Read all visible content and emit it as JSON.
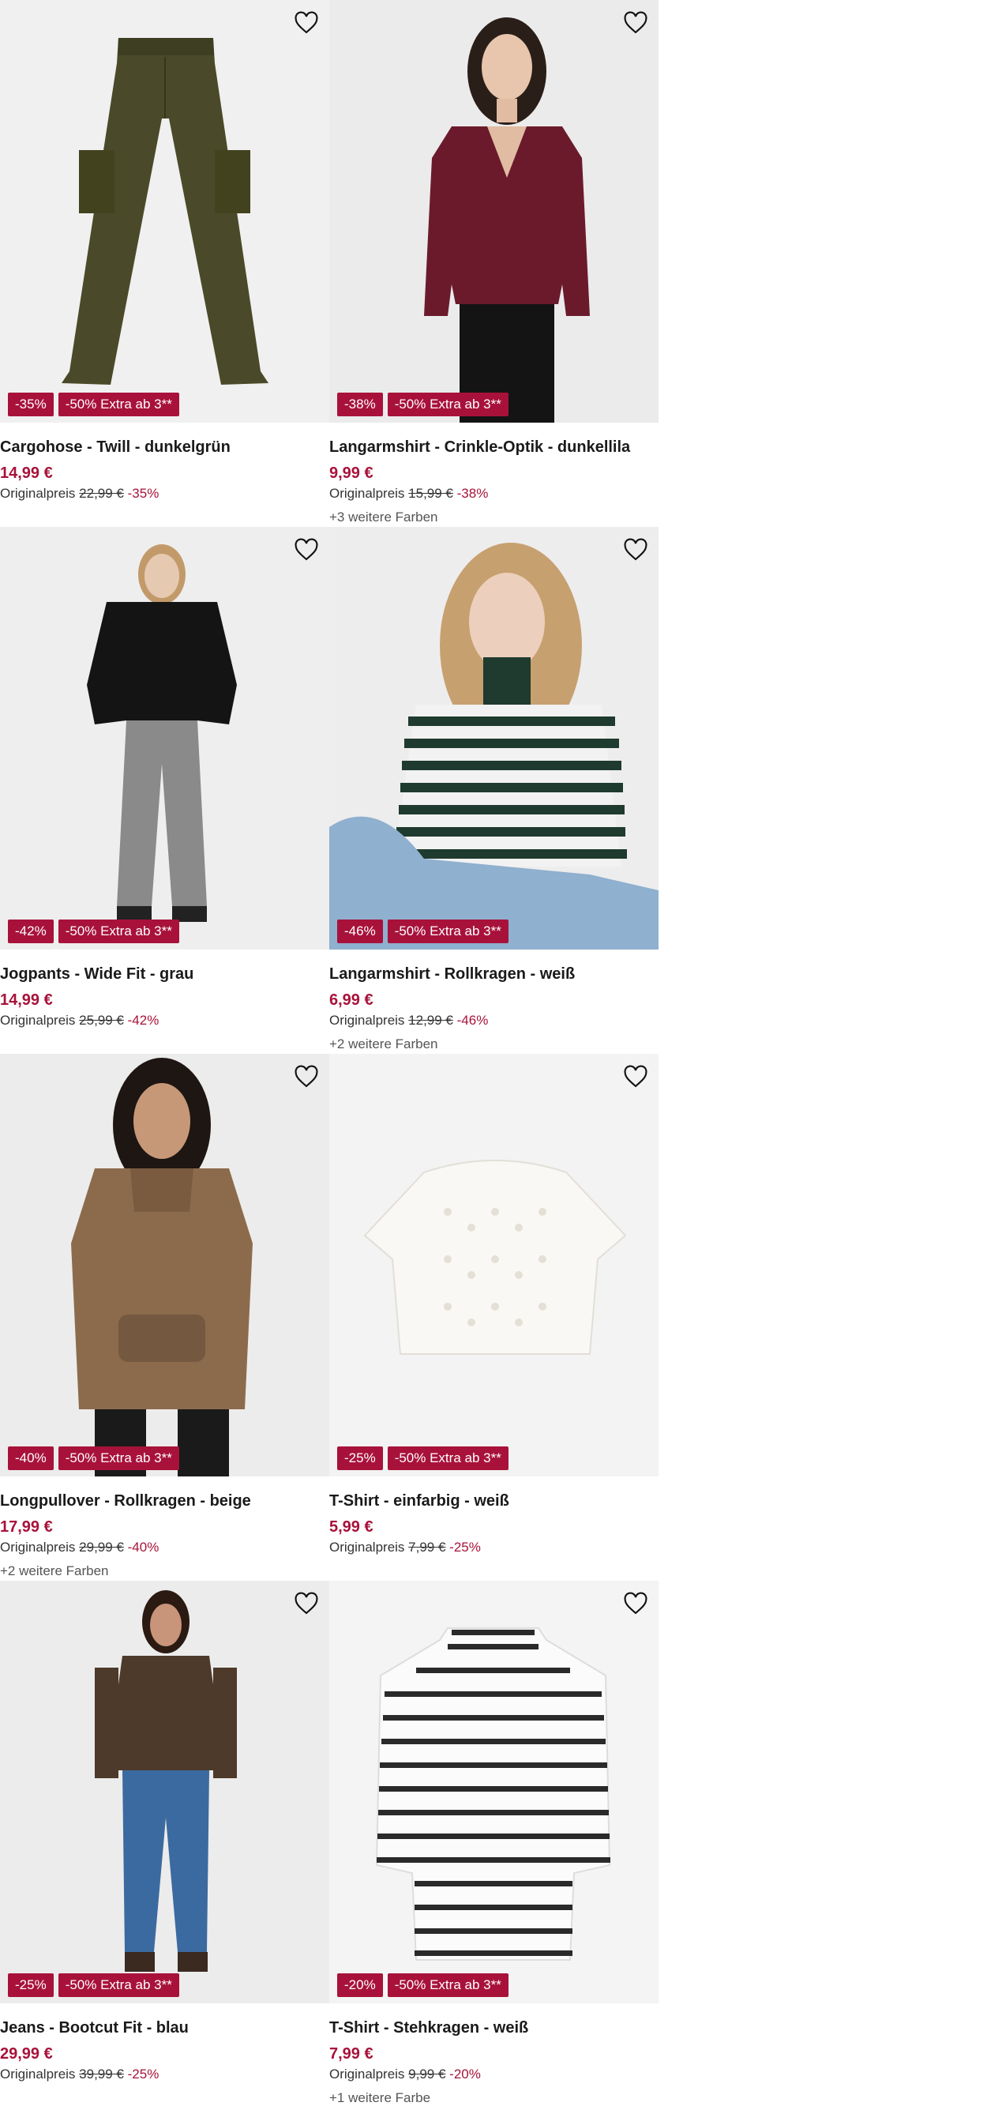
{
  "products": [
    {
      "title": "Cargohose - Twill - dunkelgrün",
      "price": "14,99 €",
      "orig_label": "Originalpreis",
      "orig_price": "22,99 €",
      "discount": "-35%",
      "badge_discount": "-35%",
      "badge_promo": "-50% Extra ab 3**",
      "colors": "",
      "icon": "cargo-pants-image"
    },
    {
      "title": "Langarmshirt - Crinkle-Optik - dunkellila",
      "price": "9,99 €",
      "orig_label": "Originalpreis",
      "orig_price": "15,99 €",
      "discount": "-38%",
      "badge_discount": "-38%",
      "badge_promo": "-50% Extra ab 3**",
      "colors": "+3 weitere Farben",
      "icon": "burgundy-shirt-model-image"
    },
    {
      "title": "Jogpants - Wide Fit - grau",
      "price": "14,99 €",
      "orig_label": "Originalpreis",
      "orig_price": "25,99 €",
      "discount": "-42%",
      "badge_discount": "-42%",
      "badge_promo": "-50% Extra ab 3**",
      "colors": "",
      "icon": "grey-jogpants-model-image"
    },
    {
      "title": "Langarmshirt - Rollkragen - weiß",
      "price": "6,99 €",
      "orig_label": "Originalpreis",
      "orig_price": "12,99 €",
      "discount": "-46%",
      "badge_discount": "-46%",
      "badge_promo": "-50% Extra ab 3**",
      "colors": "+2 weitere Farben",
      "icon": "striped-turtleneck-model-image"
    },
    {
      "title": "Longpullover - Rollkragen - beige",
      "price": "17,99 €",
      "orig_label": "Originalpreis",
      "orig_price": "29,99 €",
      "discount": "-40%",
      "badge_discount": "-40%",
      "badge_promo": "-50% Extra ab 3**",
      "colors": "+2 weitere Farben",
      "icon": "beige-longpullover-model-image"
    },
    {
      "title": "T-Shirt - einfarbig - weiß",
      "price": "5,99 €",
      "orig_label": "Originalpreis",
      "orig_price": "7,99 €",
      "discount": "-25%",
      "badge_discount": "-25%",
      "badge_promo": "-50% Extra ab 3**",
      "colors": "",
      "icon": "white-knit-tshirt-image"
    },
    {
      "title": "Jeans - Bootcut Fit - blau",
      "price": "29,99 €",
      "orig_label": "Originalpreis",
      "orig_price": "39,99 €",
      "discount": "-25%",
      "badge_discount": "-25%",
      "badge_promo": "-50% Extra ab 3**",
      "colors": "",
      "icon": "bootcut-jeans-model-image"
    },
    {
      "title": "T-Shirt - Stehkragen - weiß",
      "price": "7,99 €",
      "orig_label": "Originalpreis",
      "orig_price": "9,99 €",
      "discount": "-20%",
      "badge_discount": "-20%",
      "badge_promo": "-50% Extra ab 3**",
      "colors": "+1 weitere Farbe",
      "icon": "striped-tshirt-image"
    }
  ],
  "colors": {
    "accent": "#a8123a",
    "text": "#1a1a1a"
  },
  "wishlist_icon": "heart-outline-icon"
}
